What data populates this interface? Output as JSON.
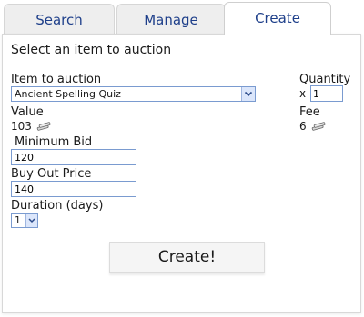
{
  "tabs": [
    {
      "label": "Search"
    },
    {
      "label": "Manage"
    },
    {
      "label": "Create"
    }
  ],
  "form": {
    "heading": "Select an item to auction",
    "item_label": "Item to auction",
    "item_selected": "Ancient Spelling Quiz",
    "quantity_label": "Quantity",
    "quantity_prefix": "x",
    "quantity_value": "1",
    "value_label": "Value",
    "value_amount": "103",
    "fee_label": "Fee",
    "fee_amount": "6",
    "min_bid_label": "Minimum Bid",
    "min_bid_value": "120",
    "buyout_label": "Buy Out Price",
    "buyout_value": "140",
    "duration_label": "Duration (days)",
    "duration_selected": "1",
    "submit_label": "Create!"
  },
  "icons": {
    "currency": "coin-stack-icon",
    "dropdown": "chevron-down-icon"
  },
  "colors": {
    "tab_text": "#1e3f8a",
    "input_border": "#7a9bd0"
  }
}
